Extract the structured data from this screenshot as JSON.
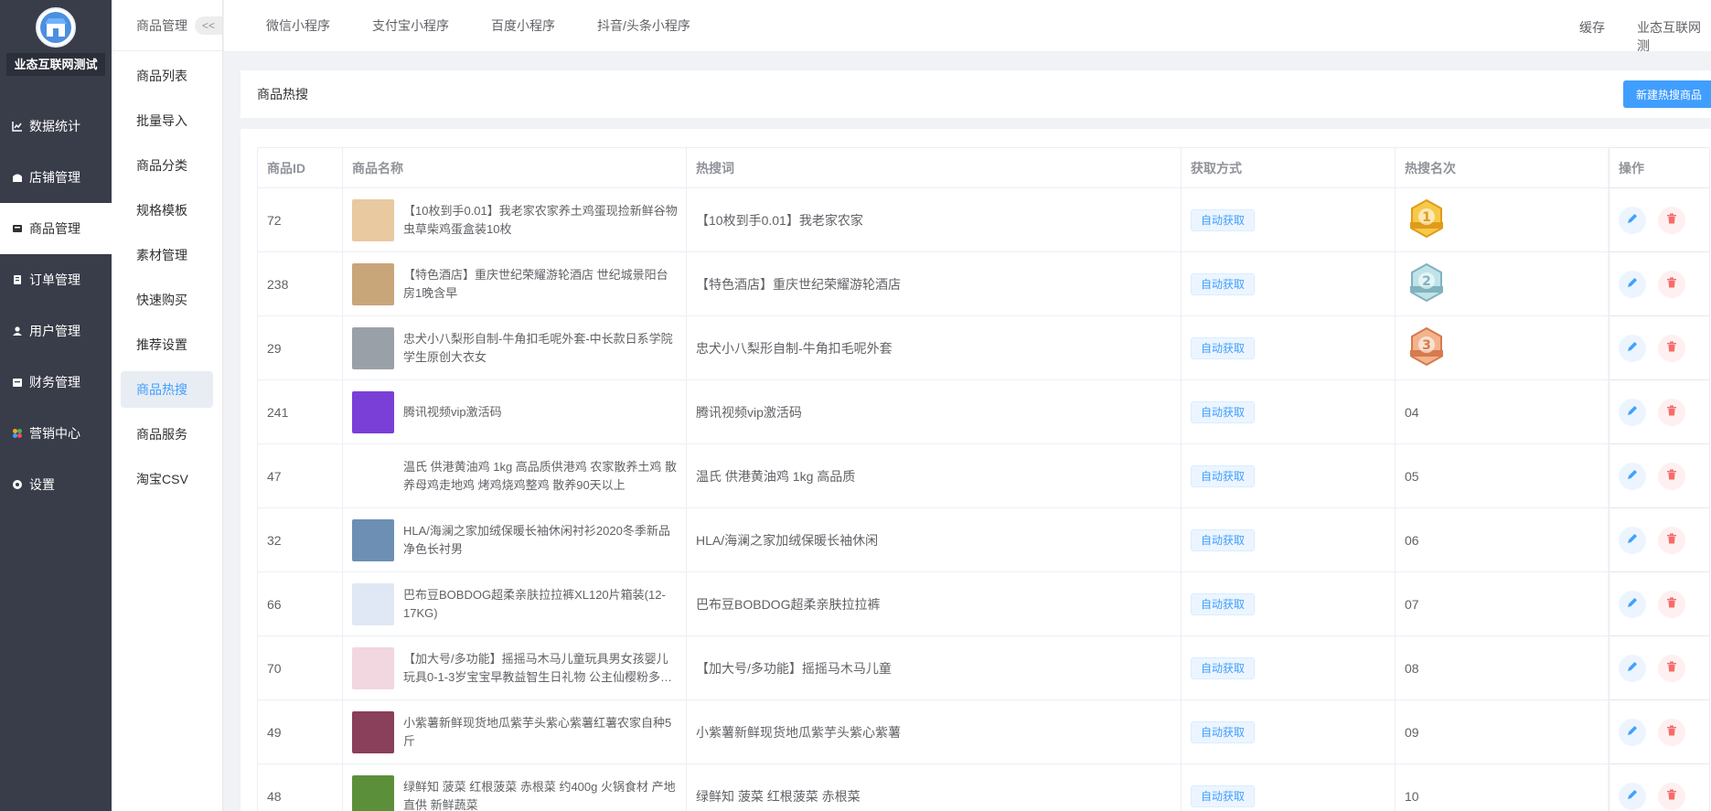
{
  "brand": {
    "name": "业态互联网测试"
  },
  "sidebar": {
    "items": [
      {
        "label": "数据统计",
        "icon": "chart-icon",
        "active": false
      },
      {
        "label": "店铺管理",
        "icon": "store-icon",
        "active": false
      },
      {
        "label": "商品管理",
        "icon": "goods-icon",
        "active": true
      },
      {
        "label": "订单管理",
        "icon": "order-icon",
        "active": false
      },
      {
        "label": "用户管理",
        "icon": "user-icon",
        "active": false
      },
      {
        "label": "财务管理",
        "icon": "finance-icon",
        "active": false
      },
      {
        "label": "营销中心",
        "icon": "marketing-icon",
        "active": false
      },
      {
        "label": "设置",
        "icon": "settings-icon",
        "active": false
      }
    ]
  },
  "submenu": {
    "title": "商品管理",
    "collapse": "<<",
    "items": [
      {
        "label": "商品列表",
        "active": false
      },
      {
        "label": "批量导入",
        "active": false
      },
      {
        "label": "商品分类",
        "active": false
      },
      {
        "label": "规格模板",
        "active": false
      },
      {
        "label": "素材管理",
        "active": false
      },
      {
        "label": "快速购买",
        "active": false
      },
      {
        "label": "推荐设置",
        "active": false
      },
      {
        "label": "商品热搜",
        "active": true
      },
      {
        "label": "商品服务",
        "active": false
      },
      {
        "label": "淘宝CSV",
        "active": false
      }
    ]
  },
  "topbar": {
    "tabs": [
      "微信小程序",
      "支付宝小程序",
      "百度小程序",
      "抖音/头条小程序"
    ],
    "cache": "缓存",
    "account": "业态互联网测"
  },
  "page": {
    "title": "商品热搜",
    "new_button": "新建热搜商品"
  },
  "table": {
    "headers": [
      "商品ID",
      "商品名称",
      "热搜词",
      "获取方式",
      "热搜名次",
      "操作"
    ],
    "rows": [
      {
        "id": "72",
        "name": "【10枚到手0.01】我老家农家养土鸡蛋现捡新鲜谷物虫草柴鸡蛋盒装10枚",
        "word": "【10枚到手0.01】我老家农家",
        "way": "自动获取",
        "rank": "1",
        "medal": "gold",
        "thumb": "#e8c9a0"
      },
      {
        "id": "238",
        "name": "【特色酒店】重庆世纪荣耀游轮酒店 世纪城景阳台房1晚含早",
        "word": "【特色酒店】重庆世纪荣耀游轮酒店",
        "way": "自动获取",
        "rank": "2",
        "medal": "silver",
        "thumb": "#c9a57a"
      },
      {
        "id": "29",
        "name": "忠犬小八梨形自制-牛角扣毛呢外套-中长款日系学院学生原创大衣女",
        "word": "忠犬小八梨形自制-牛角扣毛呢外套",
        "way": "自动获取",
        "rank": "3",
        "medal": "bronze",
        "thumb": "#9aa0a8"
      },
      {
        "id": "241",
        "name": "腾讯视频vip激活码",
        "word": "腾讯视频vip激活码",
        "way": "自动获取",
        "rank": "04",
        "medal": "",
        "thumb": "#7a3fd6"
      },
      {
        "id": "47",
        "name": "温氏 供港黄油鸡 1kg 高品质供港鸡 农家散养土鸡 散养母鸡走地鸡 烤鸡烧鸡整鸡 散养90天以上",
        "word": "温氏 供港黄油鸡 1kg 高品质",
        "way": "自动获取",
        "rank": "05",
        "medal": "",
        "thumb": "#ffffff"
      },
      {
        "id": "32",
        "name": "HLA/海澜之家加绒保暖长袖休闲衬衫2020冬季新品净色长衬男",
        "word": "HLA/海澜之家加绒保暖长袖休闲",
        "way": "自动获取",
        "rank": "06",
        "medal": "",
        "thumb": "#6d8fb3"
      },
      {
        "id": "66",
        "name": "巴布豆BOBDOG超柔亲肤拉拉裤XL120片箱装(12-17KG)",
        "word": "巴布豆BOBDOG超柔亲肤拉拉裤",
        "way": "自动获取",
        "rank": "07",
        "medal": "",
        "thumb": "#dfe8f4"
      },
      {
        "id": "70",
        "name": "【加大号/多功能】摇摇马木马儿童玩具男女孩婴儿玩具0-1-3岁宝宝早教益智生日礼物 公主仙樱粉多…",
        "word": "【加大号/多功能】摇摇马木马儿童",
        "way": "自动获取",
        "rank": "08",
        "medal": "",
        "thumb": "#f2d6e0"
      },
      {
        "id": "49",
        "name": "小紫薯新鲜现货地瓜紫芋头紫心紫薯红薯农家自种5斤",
        "word": "小紫薯新鲜现货地瓜紫芋头紫心紫薯",
        "way": "自动获取",
        "rank": "09",
        "medal": "",
        "thumb": "#8a3f5a"
      },
      {
        "id": "48",
        "name": "绿鲜知 菠菜 红根菠菜 赤根菜 约400g 火锅食材 产地直供 新鲜蔬菜",
        "word": "绿鲜知 菠菜 红根菠菜 赤根菜",
        "way": "自动获取",
        "rank": "10",
        "medal": "",
        "thumb": "#5c8f3a"
      }
    ]
  },
  "colors": {
    "accent": "#409eff",
    "sidebar": "#393d49",
    "danger": "#f56c6c"
  }
}
